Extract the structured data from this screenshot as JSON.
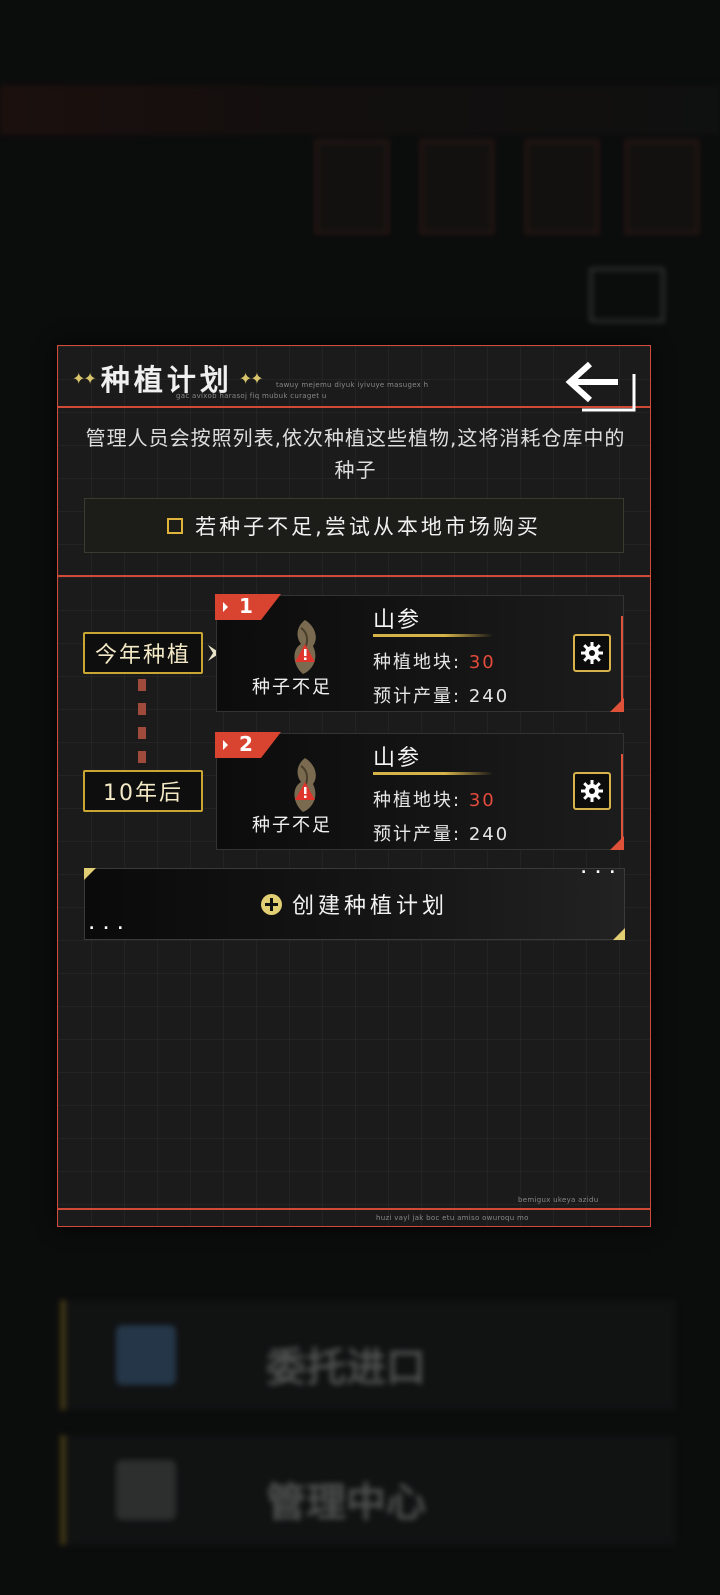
{
  "modal": {
    "title": "种植计划",
    "sparkle": "✦✦",
    "deco_text_1": "tawuy mejemu diyuk iyivuye masugex h",
    "deco_text_2": "gac avixob harasoj fiq mubuk curaget u",
    "description": "管理人员会按照列表,依次种植这些植物,这将消耗仓库中的种子",
    "checkbox_label": "若种子不足,尝试从本地市场购买",
    "checkbox_checked": false,
    "footer_deco_1": "bemigux ukeya azidu",
    "footer_deco_2": "huzi vayl jak boc etu amiso owuroqu mo"
  },
  "timeline": {
    "current_label": "今年种植",
    "later_label": "10年后"
  },
  "plans": [
    {
      "index": "1",
      "plant_name": "山参",
      "warning": "种子不足",
      "plot_label": "种植地块:",
      "plot_value": "30",
      "yield_label": "预计产量:",
      "yield_value": "240"
    },
    {
      "index": "2",
      "plant_name": "山参",
      "warning": "种子不足",
      "plot_label": "种植地块:",
      "plot_value": "30",
      "yield_label": "预计产量:",
      "yield_value": "240"
    }
  ],
  "create_button": {
    "label": "创建种植计划",
    "dots": "..."
  },
  "background": {
    "rows": [
      "",
      "",
      "委托进口",
      "管理中心"
    ]
  },
  "colors": {
    "accent_red": "#d04a38",
    "accent_gold": "#d6b24a",
    "value_red": "#e34b3c"
  }
}
